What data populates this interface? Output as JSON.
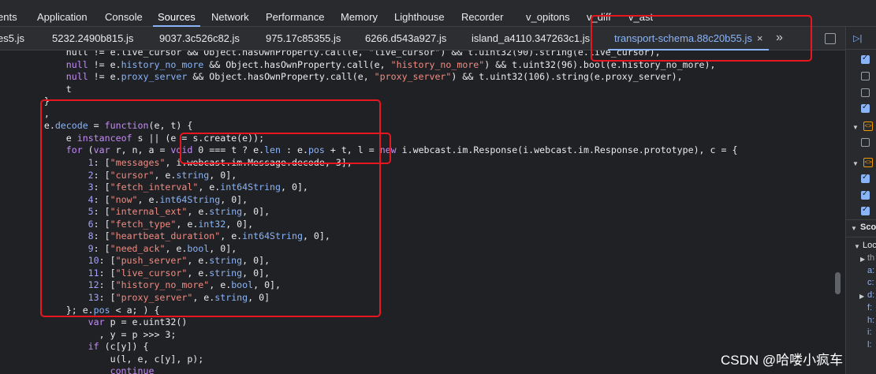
{
  "devtools_tabs": [
    {
      "label": "ents",
      "active": false
    },
    {
      "label": "Application",
      "active": false
    },
    {
      "label": "Console",
      "active": false
    },
    {
      "label": "Sources",
      "active": true
    },
    {
      "label": "Network",
      "active": false
    },
    {
      "label": "Performance",
      "active": false
    },
    {
      "label": "Memory",
      "active": false
    },
    {
      "label": "Lighthouse",
      "active": false
    },
    {
      "label": "Recorder",
      "active": false
    },
    {
      "label": "v_opitons",
      "active": false
    },
    {
      "label": "v_diff",
      "active": false
    },
    {
      "label": "v_ast",
      "active": false
    }
  ],
  "file_tabs": [
    {
      "label": "es5.js",
      "active": false
    },
    {
      "label": "5232.2490b815.js",
      "active": false
    },
    {
      "label": "9037.3c526c82.js",
      "active": false
    },
    {
      "label": "975.17c85355.js",
      "active": false
    },
    {
      "label": "6266.d543a927.js",
      "active": false
    },
    {
      "label": "island_a4110.347263c1.js",
      "active": false
    },
    {
      "label": "transport-schema.88c20b55.js",
      "active": true
    }
  ],
  "file_tab_close": "×",
  "file_tab_more": "»",
  "code_lines": [
    [
      [
        "plain",
        "            null != e.live_cursor && Object.hasOwnProperty.call(e, \"live_cursor\") && t.uint32(90).string(e.live_cursor),"
      ]
    ],
    [
      [
        "kw",
        "            null"
      ],
      [
        "plain",
        " != e."
      ],
      [
        "prop",
        "history_no_more"
      ],
      [
        "plain",
        " && Object.hasOwnProperty.call(e, "
      ],
      [
        "str",
        "\"history_no_more\""
      ],
      [
        "plain",
        ") && t.uint32(96).bool(e.history_no_more),"
      ]
    ],
    [
      [
        "kw",
        "            null"
      ],
      [
        "plain",
        " != e."
      ],
      [
        "prop",
        "proxy_server"
      ],
      [
        "plain",
        " && Object.hasOwnProperty.call(e, "
      ],
      [
        "str",
        "\"proxy_server\""
      ],
      [
        "plain",
        ") && t.uint32(106).string(e.proxy_server),"
      ]
    ],
    [
      [
        "plain",
        "            t"
      ]
    ],
    [
      [
        "plain",
        "        }"
      ]
    ],
    [
      [
        "plain",
        "        ,"
      ]
    ],
    [
      [
        "plain",
        "        e."
      ],
      [
        "prop",
        "decode"
      ],
      [
        "plain",
        " = "
      ],
      [
        "kw",
        "function"
      ],
      [
        "plain",
        "(e, t) {"
      ]
    ],
    [
      [
        "plain",
        "            e "
      ],
      [
        "kw",
        "instanceof"
      ],
      [
        "plain",
        " s || (e = s.create(e));"
      ]
    ],
    [
      [
        "kw",
        "            for"
      ],
      [
        "plain",
        " ("
      ],
      [
        "kw",
        "var"
      ],
      [
        "plain",
        " r, n, a = "
      ],
      [
        "kw",
        "void"
      ],
      [
        "plain",
        " 0 === t ? e."
      ],
      [
        "prop",
        "len"
      ],
      [
        "plain",
        " : e."
      ],
      [
        "prop",
        "pos"
      ],
      [
        "plain",
        " + t, l = "
      ],
      [
        "kw",
        "new"
      ],
      [
        "plain",
        " i.webcast.im.Response(i.webcast.im.Response.prototype), c = {"
      ]
    ],
    [
      [
        "num",
        "                1"
      ],
      [
        "plain",
        ": ["
      ],
      [
        "str",
        "\"messages\""
      ],
      [
        "plain",
        ", i.webcast.im.Message.decode, 3],"
      ]
    ],
    [
      [
        "num",
        "                2"
      ],
      [
        "plain",
        ": ["
      ],
      [
        "str",
        "\"cursor\""
      ],
      [
        "plain",
        ", e."
      ],
      [
        "prop",
        "string"
      ],
      [
        "plain",
        ", 0],"
      ]
    ],
    [
      [
        "num",
        "                3"
      ],
      [
        "plain",
        ": ["
      ],
      [
        "str",
        "\"fetch_interval\""
      ],
      [
        "plain",
        ", e."
      ],
      [
        "prop",
        "int64String"
      ],
      [
        "plain",
        ", 0],"
      ]
    ],
    [
      [
        "num",
        "                4"
      ],
      [
        "plain",
        ": ["
      ],
      [
        "str",
        "\"now\""
      ],
      [
        "plain",
        ", e."
      ],
      [
        "prop",
        "int64String"
      ],
      [
        "plain",
        ", 0],"
      ]
    ],
    [
      [
        "num",
        "                5"
      ],
      [
        "plain",
        ": ["
      ],
      [
        "str",
        "\"internal_ext\""
      ],
      [
        "plain",
        ", e."
      ],
      [
        "prop",
        "string"
      ],
      [
        "plain",
        ", 0],"
      ]
    ],
    [
      [
        "num",
        "                6"
      ],
      [
        "plain",
        ": ["
      ],
      [
        "str",
        "\"fetch_type\""
      ],
      [
        "plain",
        ", e."
      ],
      [
        "prop",
        "int32"
      ],
      [
        "plain",
        ", 0],"
      ]
    ],
    [
      [
        "num",
        "                8"
      ],
      [
        "plain",
        ": ["
      ],
      [
        "str",
        "\"heartbeat_duration\""
      ],
      [
        "plain",
        ", e."
      ],
      [
        "prop",
        "int64String"
      ],
      [
        "plain",
        ", 0],"
      ]
    ],
    [
      [
        "num",
        "                9"
      ],
      [
        "plain",
        ": ["
      ],
      [
        "str",
        "\"need_ack\""
      ],
      [
        "plain",
        ", e."
      ],
      [
        "prop",
        "bool"
      ],
      [
        "plain",
        ", 0],"
      ]
    ],
    [
      [
        "num",
        "                10"
      ],
      [
        "plain",
        ": ["
      ],
      [
        "str",
        "\"push_server\""
      ],
      [
        "plain",
        ", e."
      ],
      [
        "prop",
        "string"
      ],
      [
        "plain",
        ", 0],"
      ]
    ],
    [
      [
        "num",
        "                11"
      ],
      [
        "plain",
        ": ["
      ],
      [
        "str",
        "\"live_cursor\""
      ],
      [
        "plain",
        ", e."
      ],
      [
        "prop",
        "string"
      ],
      [
        "plain",
        ", 0],"
      ]
    ],
    [
      [
        "num",
        "                12"
      ],
      [
        "plain",
        ": ["
      ],
      [
        "str",
        "\"history_no_more\""
      ],
      [
        "plain",
        ", e."
      ],
      [
        "prop",
        "bool"
      ],
      [
        "plain",
        ", 0],"
      ]
    ],
    [
      [
        "num",
        "                13"
      ],
      [
        "plain",
        ": ["
      ],
      [
        "str",
        "\"proxy_server\""
      ],
      [
        "plain",
        ", e."
      ],
      [
        "prop",
        "string"
      ],
      [
        "plain",
        ", 0]"
      ]
    ],
    [
      [
        "plain",
        "            }; e."
      ],
      [
        "prop",
        "pos"
      ],
      [
        "plain",
        " < a; ) {"
      ]
    ],
    [
      [
        "kw",
        "                var"
      ],
      [
        "plain",
        " p = e.uint32()"
      ]
    ],
    [
      [
        "plain",
        "                  , y = p >>> 3;"
      ]
    ],
    [
      [
        "kw",
        "                if"
      ],
      [
        "plain",
        " (c[y]) {"
      ]
    ],
    [
      [
        "plain",
        "                    u(l, e, c[y], p);"
      ]
    ],
    [
      [
        "kw",
        "                    continue"
      ]
    ]
  ],
  "right_panel": {
    "section_label": "Sco",
    "local_label": "Loc",
    "scope_rows": [
      "th",
      "a:",
      "c:",
      "d:",
      "f:",
      "h:",
      "i:",
      "l:"
    ]
  },
  "watermark": "CSDN @哈喽小疯车"
}
